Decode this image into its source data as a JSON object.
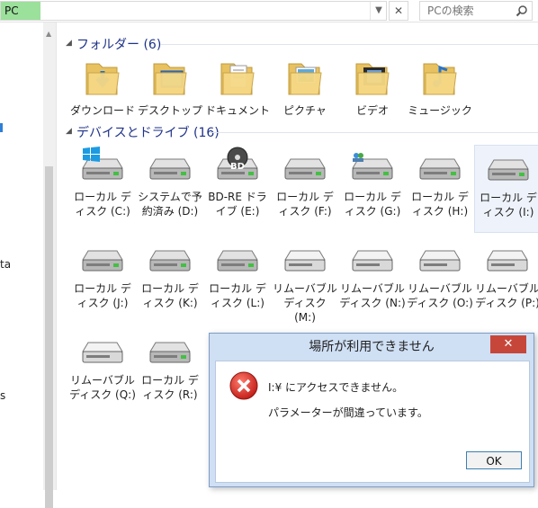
{
  "address_bar": {
    "location": "PC",
    "clear_glyph": "✕"
  },
  "search": {
    "placeholder": "PCの検索"
  },
  "nav": {
    "partial_text_1": "ta",
    "partial_text_2": "s"
  },
  "folders_group": {
    "label": "フォルダー (6)"
  },
  "folders": [
    {
      "label": "ダウンロード",
      "icon": "download-folder-icon"
    },
    {
      "label": "デスクトップ",
      "icon": "desktop-folder-icon"
    },
    {
      "label": "ドキュメント",
      "icon": "documents-folder-icon"
    },
    {
      "label": "ピクチャ",
      "icon": "pictures-folder-icon"
    },
    {
      "label": "ビデオ",
      "icon": "videos-folder-icon"
    },
    {
      "label": "ミュージック",
      "icon": "music-folder-icon"
    }
  ],
  "devices_group": {
    "label": "デバイスとドライブ (16)"
  },
  "drives": [
    {
      "label": "ローカル ディスク (C:)",
      "icon": "windows-drive-icon"
    },
    {
      "label": "システムで予約済み (D:)",
      "icon": "hard-drive-icon"
    },
    {
      "label": "BD-RE ドライブ (E:)",
      "icon": "bd-drive-icon",
      "disc_text": "BD"
    },
    {
      "label": "ローカル ディスク (F:)",
      "icon": "hard-drive-icon"
    },
    {
      "label": "ローカル ディスク (G:)",
      "icon": "shared-drive-icon"
    },
    {
      "label": "ローカル ディスク (H:)",
      "icon": "hard-drive-icon"
    },
    {
      "label": "ローカル ディスク (I:)",
      "icon": "hard-drive-icon",
      "selected": true
    },
    {
      "label": "ローカル ディスク (J:)",
      "icon": "hard-drive-icon"
    },
    {
      "label": "ローカル ディスク (K:)",
      "icon": "hard-drive-icon"
    },
    {
      "label": "ローカル ディスク (L:)",
      "icon": "hard-drive-icon"
    },
    {
      "label": "リムーバブル ディスク (M:)",
      "icon": "removable-drive-icon"
    },
    {
      "label": "リムーバブル ディスク (N:)",
      "icon": "removable-drive-icon"
    },
    {
      "label": "リムーバブル ディスク (O:)",
      "icon": "removable-drive-icon"
    },
    {
      "label": "リムーバブル ディスク (P:)",
      "icon": "removable-drive-icon"
    },
    {
      "label": "リムーバブル ディスク (Q:)",
      "icon": "removable-drive-icon"
    },
    {
      "label": "ローカル ディスク (R:)",
      "icon": "hard-drive-icon"
    }
  ],
  "dialog": {
    "title": "場所が利用できません",
    "close_glyph": "✕",
    "message": "I:¥ にアクセスできません。",
    "detail": "パラメーターが間違っています。",
    "ok_label": "OK",
    "icon": "error-icon"
  },
  "colors": {
    "accent": "#1e3287",
    "dialog_frame": "#cfdff4",
    "close_button": "#c7463a",
    "pc_highlight": "#9be09b"
  }
}
